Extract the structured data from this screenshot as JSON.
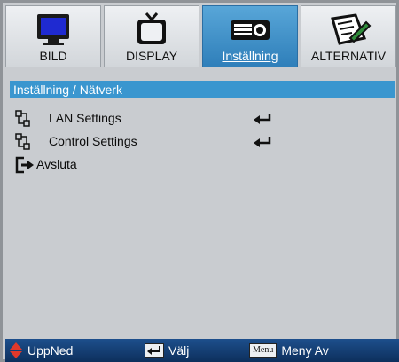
{
  "tabs": [
    {
      "label": "BILD",
      "icon": "monitor-icon"
    },
    {
      "label": "DISPLAY",
      "icon": "tv-icon"
    },
    {
      "label": "Inställning",
      "icon": "projector-icon"
    },
    {
      "label": "ALTERNATIV",
      "icon": "settings-pen-icon"
    }
  ],
  "path": "Inställning / Nätverk",
  "items": [
    {
      "label": "LAN Settings",
      "icon": "network-icon"
    },
    {
      "label": "Control Settings",
      "icon": "network-icon"
    },
    {
      "label": "Avsluta",
      "icon": "exit-icon"
    }
  ],
  "bottom": {
    "updown_label": "UppNed",
    "select_label": "Välj",
    "menu_key": "Menu",
    "menu_off_label": "Meny Av"
  },
  "colors": {
    "accent": "#3a96cf",
    "active_tab": "#2f7fba",
    "bottom_bar": "#0d2f5c"
  }
}
